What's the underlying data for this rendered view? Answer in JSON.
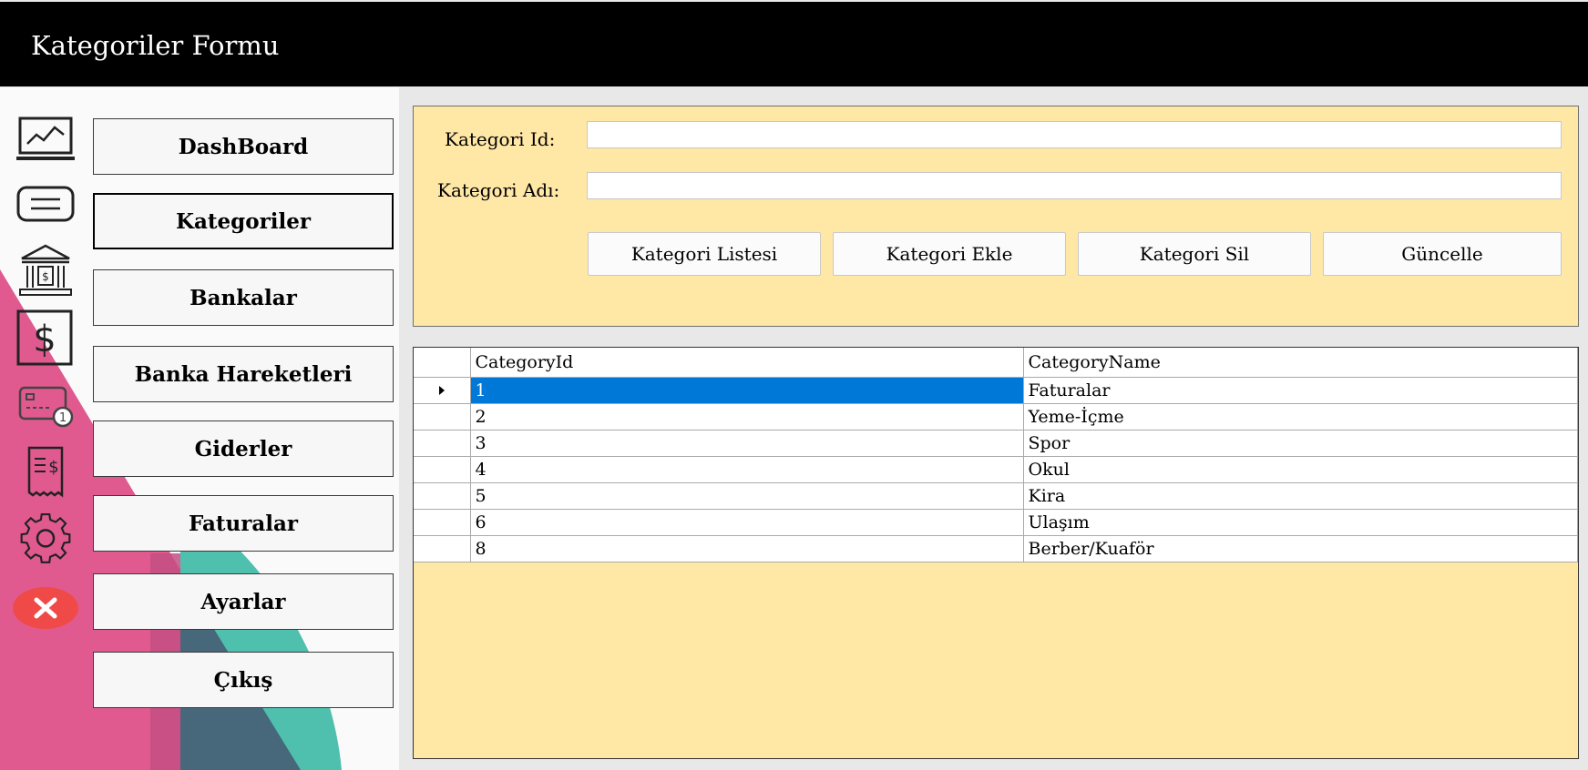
{
  "window": {
    "title": "Kategoriler Formu"
  },
  "sidebar": {
    "items": [
      {
        "label": "DashBoard",
        "icon": "chart-monitor-icon"
      },
      {
        "label": "Kategoriler",
        "icon": "list-card-icon",
        "active": true
      },
      {
        "label": "Bankalar",
        "icon": "bank-icon"
      },
      {
        "label": "Banka Hareketleri",
        "icon": "dollar-icon"
      },
      {
        "label": "Giderler",
        "icon": "credit-card-icon"
      },
      {
        "label": "Faturalar",
        "icon": "receipt-icon"
      },
      {
        "label": "Ayarlar",
        "icon": "gear-icon"
      },
      {
        "label": "Çıkış",
        "icon": "close-icon"
      }
    ]
  },
  "form": {
    "id_label": "Kategori Id:",
    "id_value": "",
    "name_label": "Kategori Adı:",
    "name_value": "",
    "buttons": {
      "list": "Kategori Listesi",
      "add": "Kategori Ekle",
      "delete": "Kategori Sil",
      "update": "Güncelle"
    }
  },
  "grid": {
    "columns": [
      "CategoryId",
      "CategoryName"
    ],
    "rows": [
      {
        "id": "1",
        "name": "Faturalar"
      },
      {
        "id": "2",
        "name": "Yeme-İçme"
      },
      {
        "id": "3",
        "name": "Spor"
      },
      {
        "id": "4",
        "name": "Okul"
      },
      {
        "id": "5",
        "name": "Kira"
      },
      {
        "id": "6",
        "name": "Ulaşım"
      },
      {
        "id": "8",
        "name": "Berber/Kuaför"
      }
    ],
    "selected_row": 0
  },
  "colors": {
    "titlebar": "#000000",
    "panel": "#ffe7a6",
    "selection": "#0078d7",
    "decor_pink": "#e05a8f",
    "decor_teal": "#4fbfae",
    "exit_red": "#f04a48"
  }
}
